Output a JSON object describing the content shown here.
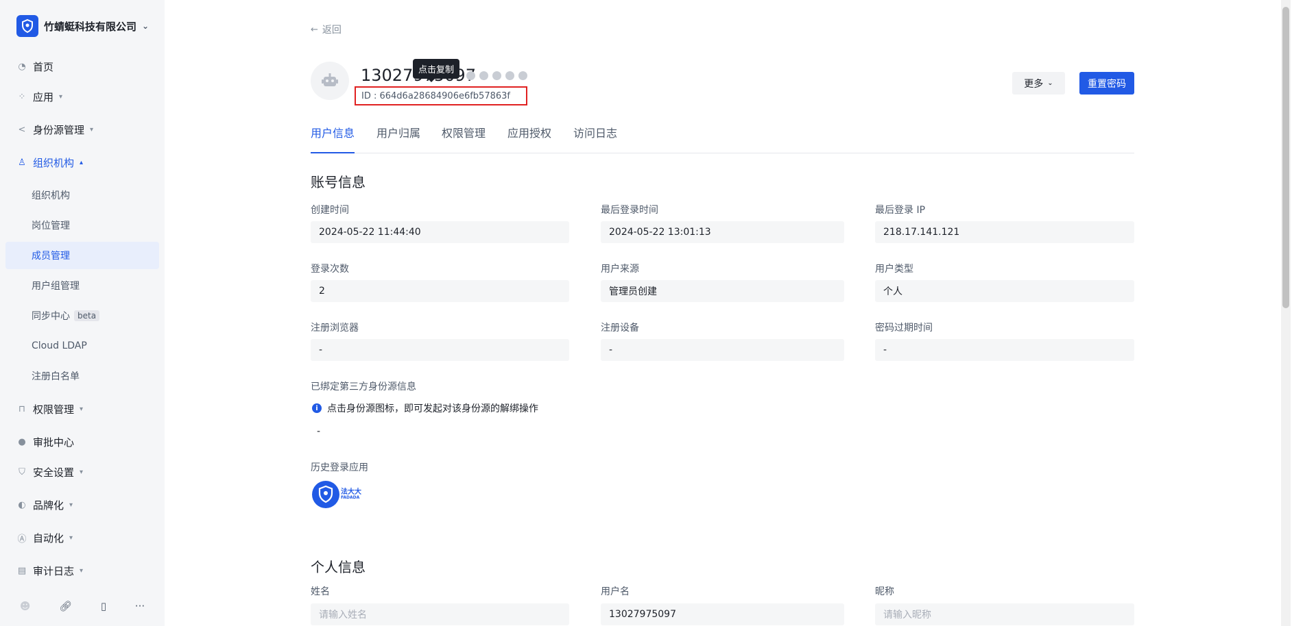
{
  "sidebar": {
    "org_name": "竹蜻蜓科技有限公司",
    "items": [
      {
        "label": "首页",
        "icon": "pie-chart-icon"
      },
      {
        "label": "应用",
        "icon": "apps-icon"
      },
      {
        "label": "身份源管理",
        "icon": "share-icon"
      },
      {
        "label": "组织机构",
        "icon": "org-icon"
      },
      {
        "label": "权限管理",
        "icon": "lock-icon"
      },
      {
        "label": "审批中心",
        "icon": "user-icon"
      },
      {
        "label": "安全设置",
        "icon": "shield-icon"
      },
      {
        "label": "品牌化",
        "icon": "palette-icon"
      },
      {
        "label": "自动化",
        "icon": "automation-icon"
      },
      {
        "label": "审计日志",
        "icon": "log-icon"
      }
    ],
    "sub_items": [
      "组织机构",
      "岗位管理",
      "成员管理",
      "用户组管理",
      "同步中心",
      "Cloud LDAP",
      "注册白名单"
    ],
    "beta_label": "beta"
  },
  "header": {
    "back_label": "返回",
    "username": "13027975097",
    "tooltip": "点击复制",
    "user_id": "ID : 664d6a28684906e6fb57863f",
    "more_label": "更多",
    "reset_label": "重置密码"
  },
  "tabs": [
    "用户信息",
    "用户归属",
    "权限管理",
    "应用授权",
    "访问日志"
  ],
  "account": {
    "title": "账号信息",
    "fields": [
      {
        "label": "创建时间",
        "value": "2024-05-22 11:44:40"
      },
      {
        "label": "最后登录时间",
        "value": "2024-05-22 13:01:13"
      },
      {
        "label": "最后登录 IP",
        "value": "218.17.141.121"
      },
      {
        "label": "登录次数",
        "value": "2"
      },
      {
        "label": "用户来源",
        "value": "管理员创建"
      },
      {
        "label": "用户类型",
        "value": "个人"
      },
      {
        "label": "注册浏览器",
        "value": "-"
      },
      {
        "label": "注册设备",
        "value": "-"
      },
      {
        "label": "密码过期时间",
        "value": "-"
      }
    ],
    "bound_label": "已绑定第三方身份源信息",
    "bound_tip": "点击身份源图标，即可发起对该身份源的解绑操作",
    "bound_value": "-",
    "history_label": "历史登录应用",
    "app_name": "法大大",
    "app_sub": "FADADA"
  },
  "personal": {
    "title": "个人信息",
    "fields": [
      {
        "label": "姓名",
        "value": "",
        "placeholder": "请输入姓名"
      },
      {
        "label": "用户名",
        "value": "13027975097",
        "placeholder": ""
      },
      {
        "label": "昵称",
        "value": "",
        "placeholder": "请输入昵称"
      }
    ]
  }
}
